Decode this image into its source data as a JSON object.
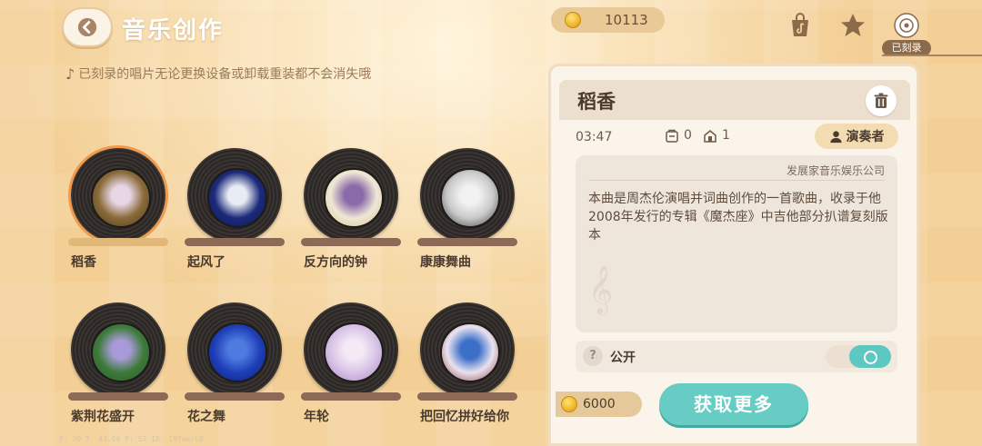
{
  "header": {
    "title": "音乐创作",
    "hint": "已刻录的唱片无论更换设备或卸载重装都不会消失哦",
    "coins": "10113",
    "recorded_tab_label": "已刻录"
  },
  "records": [
    {
      "name": "稻香",
      "selected": true,
      "art_colors": [
        "#8a6a38",
        "#e7d6e6",
        "#4d3b22"
      ]
    },
    {
      "name": "起风了",
      "selected": false,
      "art_colors": [
        "#1c2a7a",
        "#e8ecf4",
        "#0b1a50"
      ]
    },
    {
      "name": "反方向的钟",
      "selected": false,
      "art_colors": [
        "#efe7d6",
        "#8a6aa8",
        "#d9c48a"
      ]
    },
    {
      "name": "康康舞曲",
      "selected": false,
      "art_colors": [
        "#c9c9c9",
        "#f2f2f2",
        "#3a3a3a"
      ]
    },
    {
      "name": "紫荆花盛开",
      "selected": false,
      "art_colors": [
        "#3e7a3a",
        "#a89ad8",
        "#2b5a2a"
      ]
    },
    {
      "name": "花之舞",
      "selected": false,
      "art_colors": [
        "#1f3fb8",
        "#4f7ae0",
        "#0a1f7a"
      ]
    },
    {
      "name": "年轮",
      "selected": false,
      "art_colors": [
        "#d9c3e6",
        "#f4eaf6",
        "#a58bc0"
      ]
    },
    {
      "name": "把回忆拼好给你",
      "selected": false,
      "art_colors": [
        "#e9e3ef",
        "#3b6fc8",
        "#8a3a3a"
      ]
    }
  ],
  "detail": {
    "title": "稻香",
    "duration": "03:47",
    "likes": "0",
    "plays": "1",
    "performer_label": "演奏者",
    "company": "发展家音乐娱乐公司",
    "description": "本曲是周杰伦演唱并词曲创作的一首歌曲，收录于他2008年发行的专辑《魔杰座》中吉他部分扒谱复刻版本",
    "public_label": "公开",
    "public_on": true,
    "price": "6000",
    "get_more_label": "获取更多"
  },
  "debug_text": "F: 30    T: 43.00    P: 52    ID: 19femrb8",
  "colors": {
    "accent_teal": "#67cdc4",
    "selected_ring": "#f09a4c",
    "background": "#f3cf95"
  }
}
